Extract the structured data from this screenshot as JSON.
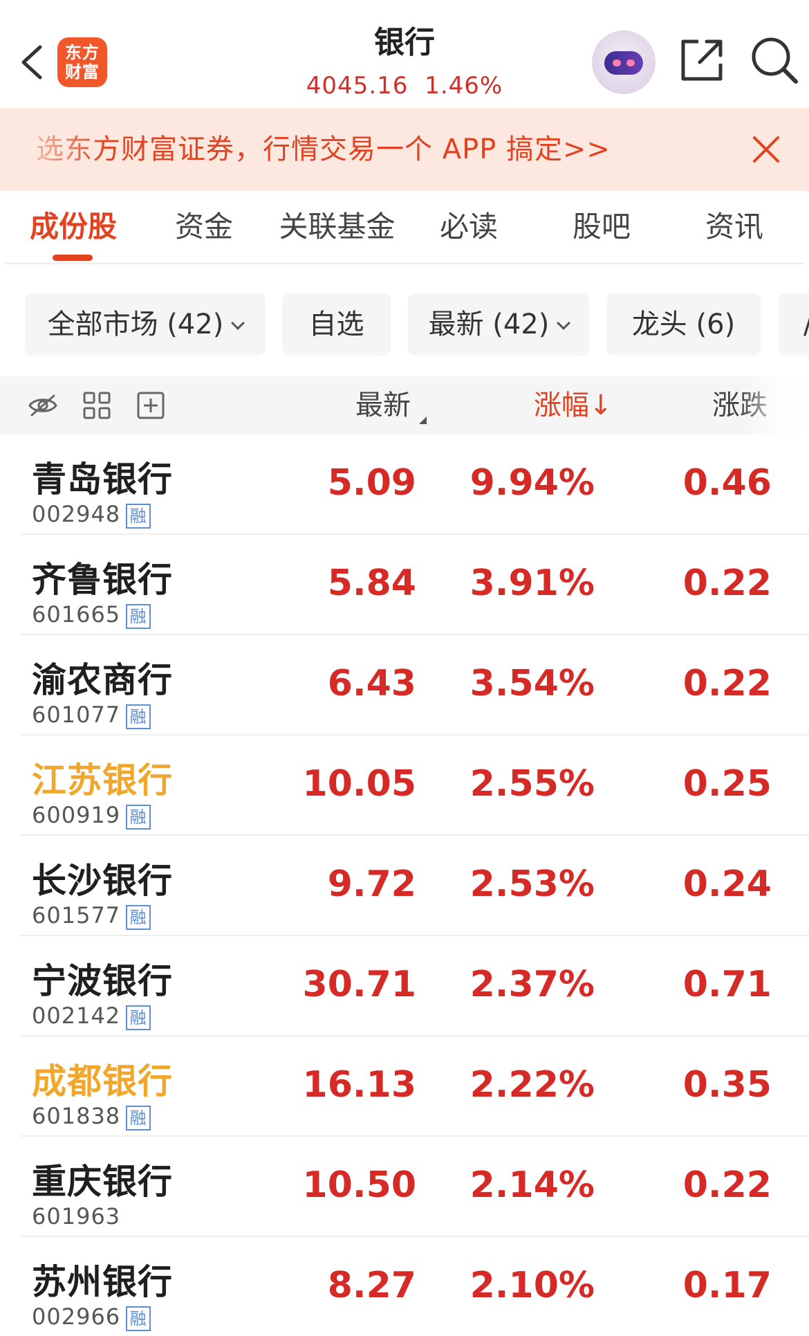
{
  "header": {
    "title": "银行",
    "index_value": "4045.16",
    "index_change_pct": "1.46%",
    "logo_line1": "东方",
    "logo_line2": "财富"
  },
  "banner": {
    "text": "选东方财富证券，行情交易一个 APP 搞定>>"
  },
  "tabs": [
    {
      "label": "成份股",
      "active": true
    },
    {
      "label": "资金"
    },
    {
      "label": "关联基金"
    },
    {
      "label": "必读"
    },
    {
      "label": "股吧"
    },
    {
      "label": "资讯"
    }
  ],
  "filters": [
    {
      "label": "全部市场 (42)",
      "has_dropdown": true
    },
    {
      "label": "自选"
    },
    {
      "label": "最新 (42)",
      "has_dropdown": true
    },
    {
      "label": "龙头 (6)"
    },
    {
      "label": "/"
    }
  ],
  "table": {
    "columns": {
      "price": "最新",
      "change_pct": "涨幅",
      "change_pct_sort": "↓",
      "change": "涨跌"
    },
    "badge_label": "融",
    "rows": [
      {
        "name": "青岛银行",
        "code": "002948",
        "price": "5.09",
        "change_pct": "9.94%",
        "change": "0.46",
        "badge": true,
        "highlight": false
      },
      {
        "name": "齐鲁银行",
        "code": "601665",
        "price": "5.84",
        "change_pct": "3.91%",
        "change": "0.22",
        "badge": true,
        "highlight": false
      },
      {
        "name": "渝农商行",
        "code": "601077",
        "price": "6.43",
        "change_pct": "3.54%",
        "change": "0.22",
        "badge": true,
        "highlight": false
      },
      {
        "name": "江苏银行",
        "code": "600919",
        "price": "10.05",
        "change_pct": "2.55%",
        "change": "0.25",
        "badge": true,
        "highlight": true
      },
      {
        "name": "长沙银行",
        "code": "601577",
        "price": "9.72",
        "change_pct": "2.53%",
        "change": "0.24",
        "badge": true,
        "highlight": false
      },
      {
        "name": "宁波银行",
        "code": "002142",
        "price": "30.71",
        "change_pct": "2.37%",
        "change": "0.71",
        "badge": true,
        "highlight": false
      },
      {
        "name": "成都银行",
        "code": "601838",
        "price": "16.13",
        "change_pct": "2.22%",
        "change": "0.35",
        "badge": true,
        "highlight": true
      },
      {
        "name": "重庆银行",
        "code": "601963",
        "price": "10.50",
        "change_pct": "2.14%",
        "change": "0.22",
        "badge": false,
        "highlight": false
      },
      {
        "name": "苏州银行",
        "code": "002966",
        "price": "8.27",
        "change_pct": "2.10%",
        "change": "0.17",
        "badge": true,
        "highlight": false
      }
    ]
  },
  "colors": {
    "up_red": "#d62a26",
    "accent_orange": "#e2421f",
    "highlight_gold": "#f0a72c",
    "badge_blue": "#5b8ed6",
    "banner_bg": "#fde8df"
  }
}
